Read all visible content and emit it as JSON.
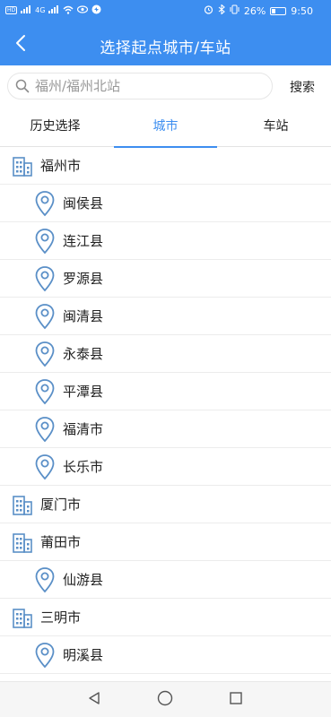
{
  "status_bar": {
    "left_chips": [
      "HD",
      "4G",
      "4G",
      "HD"
    ],
    "battery_percent": "26%",
    "time": "9:50",
    "battery_level": 0.26
  },
  "header": {
    "title": "选择起点城市/车站",
    "back_icon": "chevron-left-icon"
  },
  "search": {
    "placeholder": "福州/福州北站",
    "value": "",
    "button_label": "搜索"
  },
  "tabs": [
    {
      "label": "历史选择",
      "active": false
    },
    {
      "label": "城市",
      "active": true
    },
    {
      "label": "车站",
      "active": false
    }
  ],
  "list": [
    {
      "type": "city",
      "label": "福州市"
    },
    {
      "type": "county",
      "label": "闽侯县"
    },
    {
      "type": "county",
      "label": "连江县"
    },
    {
      "type": "county",
      "label": "罗源县"
    },
    {
      "type": "county",
      "label": "闽清县"
    },
    {
      "type": "county",
      "label": "永泰县"
    },
    {
      "type": "county",
      "label": "平潭县"
    },
    {
      "type": "county",
      "label": "福清市"
    },
    {
      "type": "county",
      "label": "长乐市"
    },
    {
      "type": "city",
      "label": "厦门市"
    },
    {
      "type": "city",
      "label": "莆田市"
    },
    {
      "type": "county",
      "label": "仙游县"
    },
    {
      "type": "city",
      "label": "三明市"
    },
    {
      "type": "county",
      "label": "明溪县"
    }
  ],
  "colors": {
    "primary": "#3d8ef0",
    "icon": "#5a8fc7"
  }
}
